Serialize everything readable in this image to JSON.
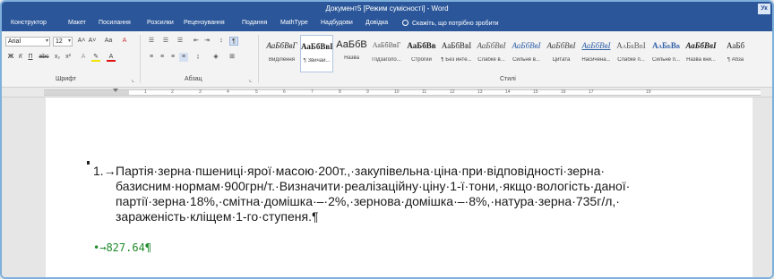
{
  "window": {
    "title": "Документ5 [Режим сумісності]  -  Word",
    "user_initials": "Ук"
  },
  "tabs": [
    "Конструктор",
    "Макет",
    "Посилання",
    "Розсилки",
    "Рецензування",
    "Подання",
    "MathType",
    "Надбудови",
    "Довідка"
  ],
  "tell_me": "Скажіть, що потрібно зробити",
  "font_group": {
    "font_name": "Arial",
    "font_size": "12",
    "grow_font": "A˄",
    "shrink_font": "A˅",
    "change_case": "Aa",
    "clear_format": "A",
    "bold": "Ж",
    "italic": "К",
    "underline": "П",
    "strike": "abc",
    "subscript": "x₂",
    "superscript": "x²",
    "label": "Шрифт"
  },
  "paragraph_group": {
    "label": "Абзац"
  },
  "styles_group": {
    "label": "Стилі",
    "styles": [
      {
        "sample": "АаБбВвГ",
        "name": "Виділення"
      },
      {
        "sample": "АаБбВвГ",
        "name": "¶ Звичай..."
      },
      {
        "sample": "АаБбВ",
        "name": "Назва"
      },
      {
        "sample": "АаБбВвГ",
        "name": "Підзаголо..."
      },
      {
        "sample": "АаБбВв",
        "name": "Строгий"
      },
      {
        "sample": "АаБбВвІ",
        "name": "¶ Без инте..."
      },
      {
        "sample": "АаБбВвІ",
        "name": "Слабке в..."
      },
      {
        "sample": "АаБбВвІ",
        "name": "Сильне в..."
      },
      {
        "sample": "АаБбВвІ",
        "name": "Цитата"
      },
      {
        "sample": "АаБбВвІ",
        "name": "Насичена..."
      },
      {
        "sample": "АаБбВвІ",
        "name": "Слабке п..."
      },
      {
        "sample": "АаБбВв",
        "name": "Сильне п..."
      },
      {
        "sample": "АаБбВвІ",
        "name": "Назва кни..."
      },
      {
        "sample": "АаБб",
        "name": "¶ Абза"
      }
    ]
  },
  "ruler": {
    "numbers": [
      "1",
      "2",
      "3",
      "4",
      "5",
      "6",
      "7",
      "8",
      "9",
      "10",
      "11",
      "12",
      "13",
      "14",
      "15",
      "16",
      "17",
      "19"
    ]
  },
  "document": {
    "list_number": "1.→",
    "problem_text": "Партія·зерна·пшениці·ярої·масою·200т.,·закупівельна·ціна·при·відповідності·зерна· базисним·нормам·900грн/т.·Визначити·реалізаційну·ціну·1-ї·тони,·якщо·вологість·даної· партії·зерна·18%,·смітна·домішка·–·2%,·зернова·домішка·–·8%,·натура·зерна·735г/л,· зараженість·кліщем·1-го·ступеня.¶",
    "answer": "•→827.64¶"
  },
  "colors": {
    "accent": "#2b579a",
    "answer_text": "#1e8a2a"
  }
}
